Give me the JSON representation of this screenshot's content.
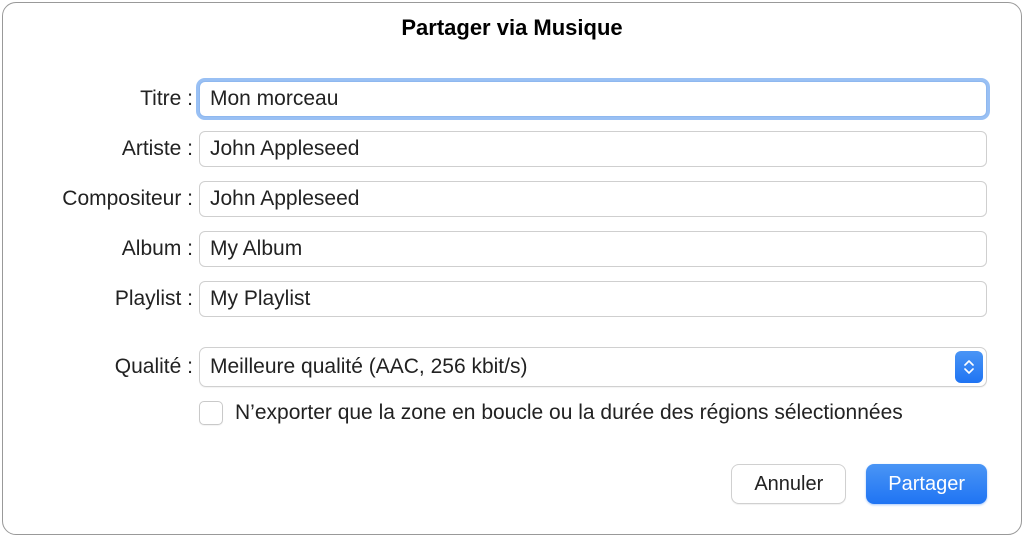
{
  "dialog": {
    "title": "Partager via Musique"
  },
  "fields": {
    "title": {
      "label": "Titre :",
      "value": "Mon morceau"
    },
    "artist": {
      "label": "Artiste :",
      "value": "John Appleseed"
    },
    "composer": {
      "label": "Compositeur :",
      "value": "John Appleseed"
    },
    "album": {
      "label": "Album :",
      "value": "My Album"
    },
    "playlist": {
      "label": "Playlist :",
      "value": "My Playlist"
    },
    "quality": {
      "label": "Qualité :",
      "value": "Meilleure qualité (AAC, 256 kbit/s)"
    }
  },
  "checkbox": {
    "label": "N’exporter que la zone en boucle ou la durée des régions sélectionnées",
    "checked": false
  },
  "buttons": {
    "cancel": "Annuler",
    "share": "Partager"
  }
}
